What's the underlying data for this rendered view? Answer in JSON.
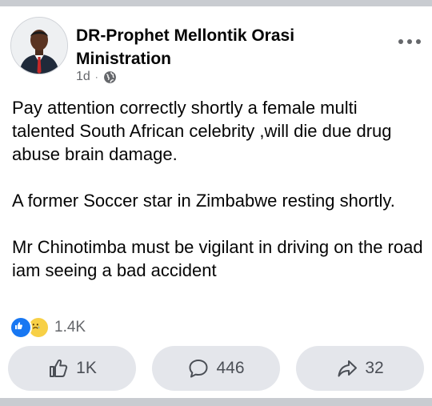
{
  "post": {
    "author": "DR-Prophet Mellontik Orasi Ministration",
    "time": "1d",
    "separator": "·",
    "audience_icon": "globe-icon",
    "menu_icon": "more-dots-icon",
    "paragraphs": [
      "Pay attention correctly shortly a female multi talented South African celebrity ,will die due drug abuse brain damage.",
      "A former Soccer star in Zimbabwe resting shortly.",
      "Mr Chinotimba must be vigilant in driving on the road iam seeing a bad accident"
    ]
  },
  "reactions": {
    "icons": [
      "like-reaction-icon",
      "sad-reaction-icon"
    ],
    "count": "1.4K"
  },
  "actions": {
    "like": {
      "icon": "thumbs-up-icon",
      "count": "1K"
    },
    "comment": {
      "icon": "comment-icon",
      "count": "446"
    },
    "share": {
      "icon": "share-arrow-icon",
      "count": "32"
    }
  },
  "colors": {
    "accent": "#1877f2",
    "secondary_text": "#65676b",
    "button_bg": "#e4e6eb",
    "divider": "#c9ccd1"
  }
}
